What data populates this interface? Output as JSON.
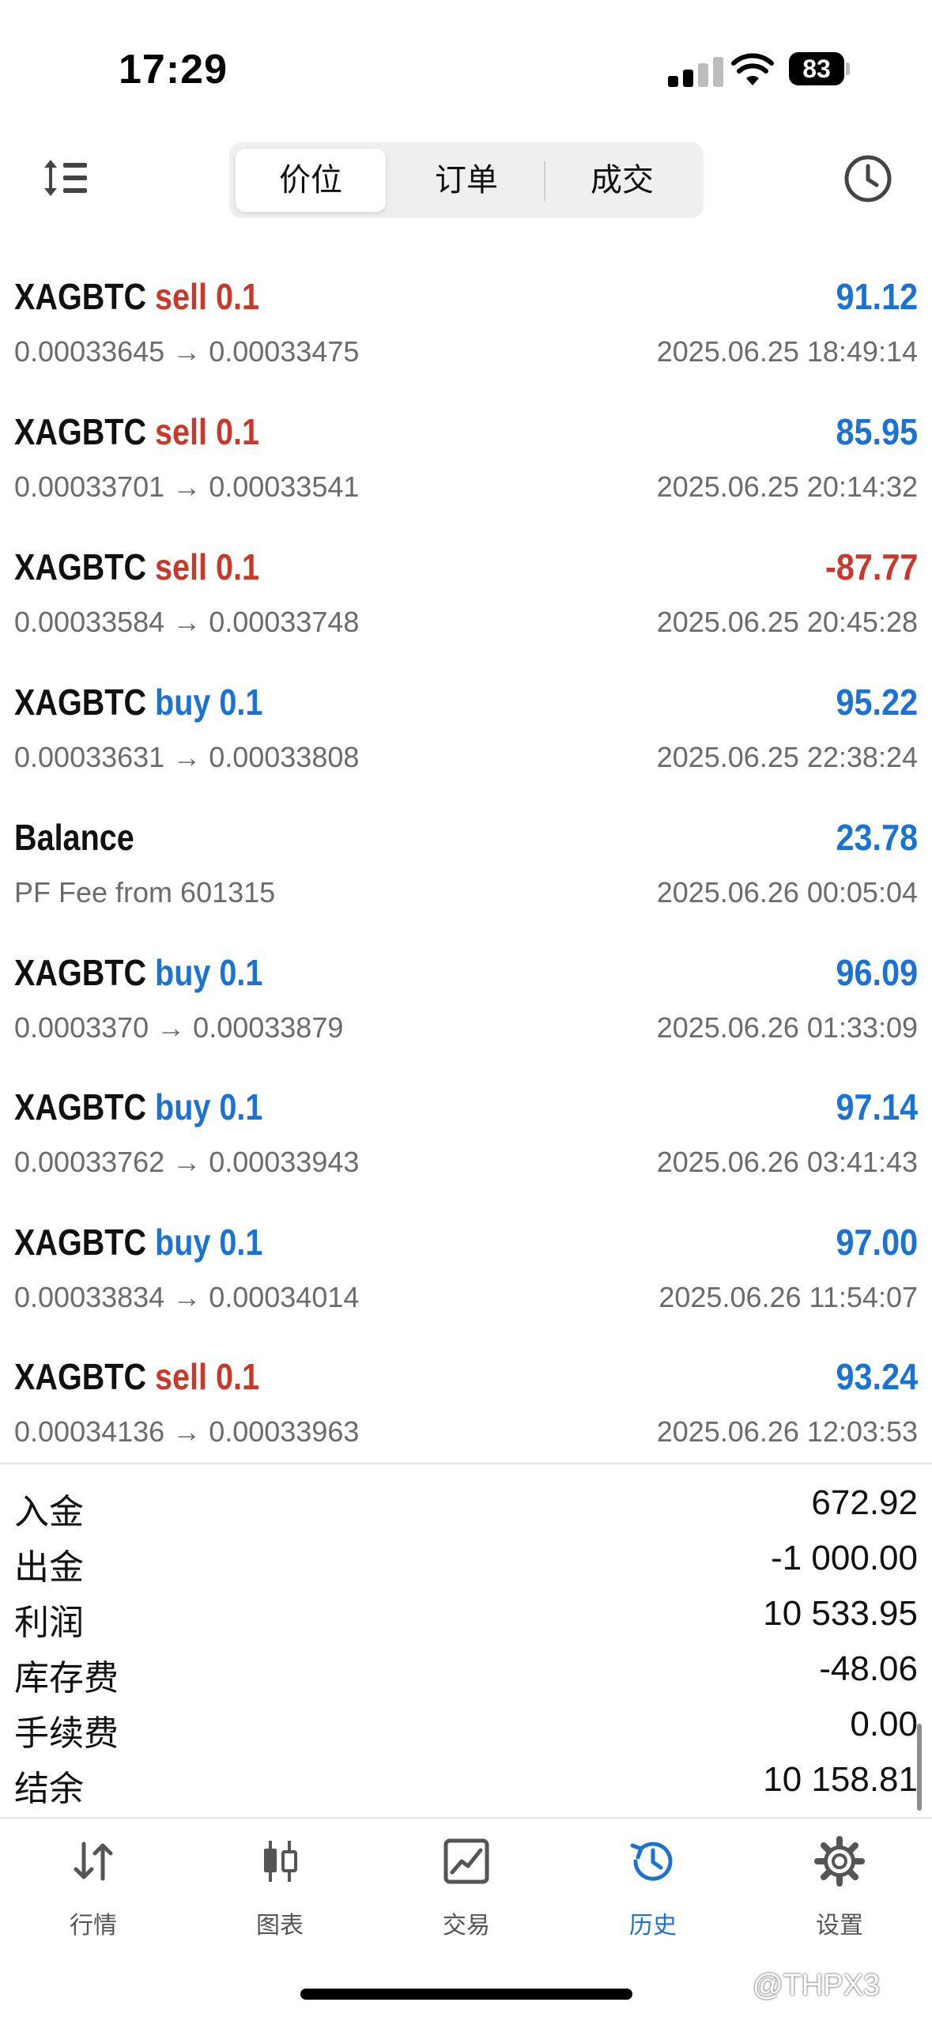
{
  "status_bar": {
    "time": "17:29",
    "battery": "83"
  },
  "segments": [
    "价位",
    "订单",
    "成交"
  ],
  "deals": [
    {
      "symbol": "XAGBTC",
      "type": "sell",
      "volume": "0.1",
      "prices": "0.00033645 → 0.00033475",
      "time": "2025.06.25 18:49:14",
      "profit": "91.12",
      "profit_color": "#1a73d4"
    },
    {
      "symbol": "XAGBTC",
      "type": "sell",
      "volume": "0.1",
      "prices": "0.00033701 → 0.00033541",
      "time": "2025.06.25 20:14:32",
      "profit": "85.95",
      "profit_color": "#1a73d4"
    },
    {
      "symbol": "XAGBTC",
      "type": "sell",
      "volume": "0.1",
      "prices": "0.00033584 → 0.00033748",
      "time": "2025.06.25 20:45:28",
      "profit": "-87.77",
      "profit_color": "#c8392b"
    },
    {
      "symbol": "XAGBTC",
      "type": "buy",
      "volume": "0.1",
      "prices": "0.00033631 → 0.00033808",
      "time": "2025.06.25 22:38:24",
      "profit": "95.22",
      "profit_color": "#1a73d4"
    },
    {
      "symbol": "Balance",
      "type": "",
      "volume": "",
      "prices": "PF Fee from 601315",
      "time": "2025.06.26 00:05:04",
      "profit": "23.78",
      "profit_color": "#1a73d4"
    },
    {
      "symbol": "XAGBTC",
      "type": "buy",
      "volume": "0.1",
      "prices": "0.0003370 → 0.00033879",
      "time": "2025.06.26 01:33:09",
      "profit": "96.09",
      "profit_color": "#1a73d4"
    },
    {
      "symbol": "XAGBTC",
      "type": "buy",
      "volume": "0.1",
      "prices": "0.00033762 → 0.00033943",
      "time": "2025.06.26 03:41:43",
      "profit": "97.14",
      "profit_color": "#1a73d4"
    },
    {
      "symbol": "XAGBTC",
      "type": "buy",
      "volume": "0.1",
      "prices": "0.00033834 → 0.00034014",
      "time": "2025.06.26 11:54:07",
      "profit": "97.00",
      "profit_color": "#1a73d4"
    },
    {
      "symbol": "XAGBTC",
      "type": "sell",
      "volume": "0.1",
      "prices": "0.00034136 → 0.00033963",
      "time": "2025.06.26 12:03:53",
      "profit": "93.24",
      "profit_color": "#1a73d4"
    }
  ],
  "colors": {
    "sell": "#c8392b",
    "buy": "#1a73d4",
    "accent": "#1a73d4"
  },
  "summary": [
    {
      "label": "入金",
      "value": "672.92"
    },
    {
      "label": "出金",
      "value": "-1 000.00"
    },
    {
      "label": "利润",
      "value": "10 533.95"
    },
    {
      "label": "库存费",
      "value": "-48.06"
    },
    {
      "label": "手续费",
      "value": "0.00"
    },
    {
      "label": "结余",
      "value": "10 158.81"
    }
  ],
  "tabs": [
    {
      "label": "行情",
      "icon": "quotes-arrows-icon"
    },
    {
      "label": "图表",
      "icon": "candlestick-chart-icon"
    },
    {
      "label": "交易",
      "icon": "trade-chart-icon"
    },
    {
      "label": "历史",
      "icon": "history-icon"
    },
    {
      "label": "设置",
      "icon": "gear-icon"
    }
  ],
  "active_tab": "历史",
  "watermark": "@THPX3"
}
